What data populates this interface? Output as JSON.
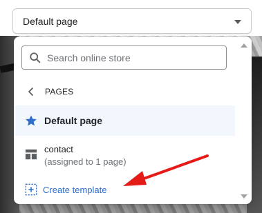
{
  "top_select": {
    "value": "Default page"
  },
  "dropdown": {
    "search": {
      "placeholder": "Search online store"
    },
    "section_header": "PAGES",
    "items": [
      {
        "label": "Default page",
        "selected": true,
        "icon": "star-icon"
      },
      {
        "label": "contact",
        "sublabel": "(assigned to 1 page)",
        "icon": "template-icon"
      }
    ],
    "create_label": "Create template"
  },
  "colors": {
    "accent_link": "#2c6ecb",
    "star": "#2c6ecb",
    "selected_row_bg": "#f2f7fe",
    "annotation_arrow": "#e41b17"
  }
}
